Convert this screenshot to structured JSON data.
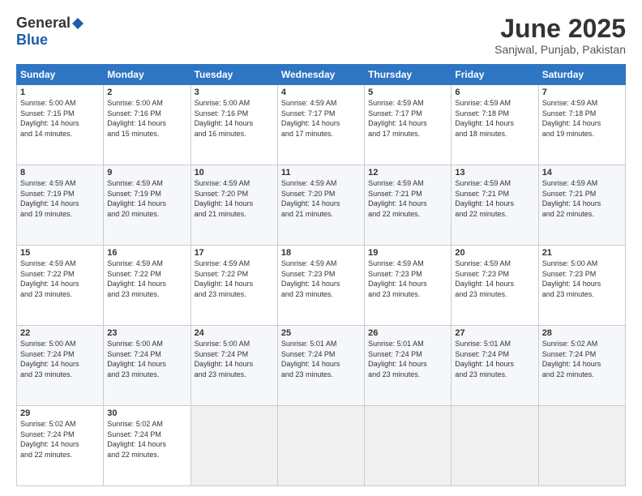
{
  "logo": {
    "general": "General",
    "blue": "Blue"
  },
  "title": "June 2025",
  "location": "Sanjwal, Punjab, Pakistan",
  "days_header": [
    "Sunday",
    "Monday",
    "Tuesday",
    "Wednesday",
    "Thursday",
    "Friday",
    "Saturday"
  ],
  "weeks": [
    [
      {
        "day": "1",
        "info": "Sunrise: 5:00 AM\nSunset: 7:15 PM\nDaylight: 14 hours\nand 14 minutes."
      },
      {
        "day": "2",
        "info": "Sunrise: 5:00 AM\nSunset: 7:16 PM\nDaylight: 14 hours\nand 15 minutes."
      },
      {
        "day": "3",
        "info": "Sunrise: 5:00 AM\nSunset: 7:16 PM\nDaylight: 14 hours\nand 16 minutes."
      },
      {
        "day": "4",
        "info": "Sunrise: 4:59 AM\nSunset: 7:17 PM\nDaylight: 14 hours\nand 17 minutes."
      },
      {
        "day": "5",
        "info": "Sunrise: 4:59 AM\nSunset: 7:17 PM\nDaylight: 14 hours\nand 17 minutes."
      },
      {
        "day": "6",
        "info": "Sunrise: 4:59 AM\nSunset: 7:18 PM\nDaylight: 14 hours\nand 18 minutes."
      },
      {
        "day": "7",
        "info": "Sunrise: 4:59 AM\nSunset: 7:18 PM\nDaylight: 14 hours\nand 19 minutes."
      }
    ],
    [
      {
        "day": "8",
        "info": "Sunrise: 4:59 AM\nSunset: 7:19 PM\nDaylight: 14 hours\nand 19 minutes."
      },
      {
        "day": "9",
        "info": "Sunrise: 4:59 AM\nSunset: 7:19 PM\nDaylight: 14 hours\nand 20 minutes."
      },
      {
        "day": "10",
        "info": "Sunrise: 4:59 AM\nSunset: 7:20 PM\nDaylight: 14 hours\nand 21 minutes."
      },
      {
        "day": "11",
        "info": "Sunrise: 4:59 AM\nSunset: 7:20 PM\nDaylight: 14 hours\nand 21 minutes."
      },
      {
        "day": "12",
        "info": "Sunrise: 4:59 AM\nSunset: 7:21 PM\nDaylight: 14 hours\nand 22 minutes."
      },
      {
        "day": "13",
        "info": "Sunrise: 4:59 AM\nSunset: 7:21 PM\nDaylight: 14 hours\nand 22 minutes."
      },
      {
        "day": "14",
        "info": "Sunrise: 4:59 AM\nSunset: 7:21 PM\nDaylight: 14 hours\nand 22 minutes."
      }
    ],
    [
      {
        "day": "15",
        "info": "Sunrise: 4:59 AM\nSunset: 7:22 PM\nDaylight: 14 hours\nand 23 minutes."
      },
      {
        "day": "16",
        "info": "Sunrise: 4:59 AM\nSunset: 7:22 PM\nDaylight: 14 hours\nand 23 minutes."
      },
      {
        "day": "17",
        "info": "Sunrise: 4:59 AM\nSunset: 7:22 PM\nDaylight: 14 hours\nand 23 minutes."
      },
      {
        "day": "18",
        "info": "Sunrise: 4:59 AM\nSunset: 7:23 PM\nDaylight: 14 hours\nand 23 minutes."
      },
      {
        "day": "19",
        "info": "Sunrise: 4:59 AM\nSunset: 7:23 PM\nDaylight: 14 hours\nand 23 minutes."
      },
      {
        "day": "20",
        "info": "Sunrise: 4:59 AM\nSunset: 7:23 PM\nDaylight: 14 hours\nand 23 minutes."
      },
      {
        "day": "21",
        "info": "Sunrise: 5:00 AM\nSunset: 7:23 PM\nDaylight: 14 hours\nand 23 minutes."
      }
    ],
    [
      {
        "day": "22",
        "info": "Sunrise: 5:00 AM\nSunset: 7:24 PM\nDaylight: 14 hours\nand 23 minutes."
      },
      {
        "day": "23",
        "info": "Sunrise: 5:00 AM\nSunset: 7:24 PM\nDaylight: 14 hours\nand 23 minutes."
      },
      {
        "day": "24",
        "info": "Sunrise: 5:00 AM\nSunset: 7:24 PM\nDaylight: 14 hours\nand 23 minutes."
      },
      {
        "day": "25",
        "info": "Sunrise: 5:01 AM\nSunset: 7:24 PM\nDaylight: 14 hours\nand 23 minutes."
      },
      {
        "day": "26",
        "info": "Sunrise: 5:01 AM\nSunset: 7:24 PM\nDaylight: 14 hours\nand 23 minutes."
      },
      {
        "day": "27",
        "info": "Sunrise: 5:01 AM\nSunset: 7:24 PM\nDaylight: 14 hours\nand 23 minutes."
      },
      {
        "day": "28",
        "info": "Sunrise: 5:02 AM\nSunset: 7:24 PM\nDaylight: 14 hours\nand 22 minutes."
      }
    ],
    [
      {
        "day": "29",
        "info": "Sunrise: 5:02 AM\nSunset: 7:24 PM\nDaylight: 14 hours\nand 22 minutes."
      },
      {
        "day": "30",
        "info": "Sunrise: 5:02 AM\nSunset: 7:24 PM\nDaylight: 14 hours\nand 22 minutes."
      },
      {
        "day": "",
        "info": ""
      },
      {
        "day": "",
        "info": ""
      },
      {
        "day": "",
        "info": ""
      },
      {
        "day": "",
        "info": ""
      },
      {
        "day": "",
        "info": ""
      }
    ]
  ]
}
